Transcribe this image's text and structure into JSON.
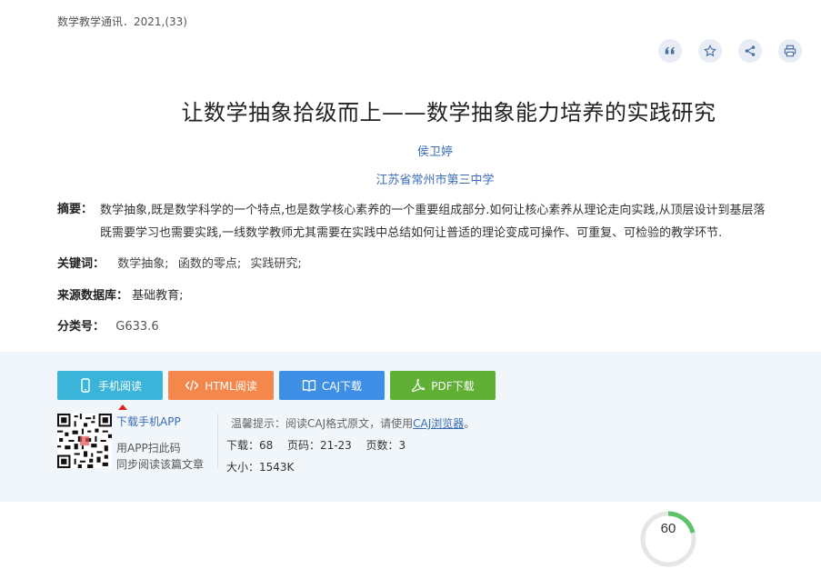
{
  "source": "数学教学通讯．2021,(33)",
  "toolbar": {
    "icons": [
      "quote-icon",
      "star-icon",
      "share-icon",
      "print-icon"
    ]
  },
  "article": {
    "title": "让数学抽象拾级而上——数学抽象能力培养的实践研究",
    "author": "侯卫婷",
    "organization": "江苏省常州市第三中学",
    "abstract_label": "摘要：",
    "abstract_line1": "数学抽象,既是数学科学的一个特点,也是数学核心素养的一个重要组成部分.如何让核心素养从理论走向实践,从顶层设计到基层落",
    "abstract_line2": "既需要学习也需要实践,一线数学教师尤其需要在实践中总结如何让普适的理论变成可操作、可重复、可检验的教学环节.",
    "keywords_label": "关键词：",
    "keywords": [
      "数学抽象;",
      "函数的零点;",
      "实践研究;"
    ],
    "database_label": "来源数据库：",
    "database": "基础教育;",
    "class_label": "分类号：",
    "class_no": "G633.6"
  },
  "buttons": {
    "mobile": "手机阅读",
    "html": "HTML阅读",
    "caj": "CAJ下载",
    "pdf": "PDF下载"
  },
  "colors": {
    "mobile": "#3bb4d9",
    "html": "#f4874b",
    "caj": "#3d8fe6",
    "pdf": "#5fb034"
  },
  "app": {
    "link": "下载手机APP",
    "line1": "用APP扫此码",
    "line2": "同步阅读该篇文章"
  },
  "tip": {
    "prefix": "温馨提示：阅读CAJ格式原文，请使用",
    "link": "CAJ浏览器",
    "suffix": "。"
  },
  "stats": {
    "downloads": "下载：68",
    "pages": "页码：21-23",
    "page_count": "页数：3",
    "size": "大小：1543K"
  },
  "gauge": {
    "value": "60"
  }
}
